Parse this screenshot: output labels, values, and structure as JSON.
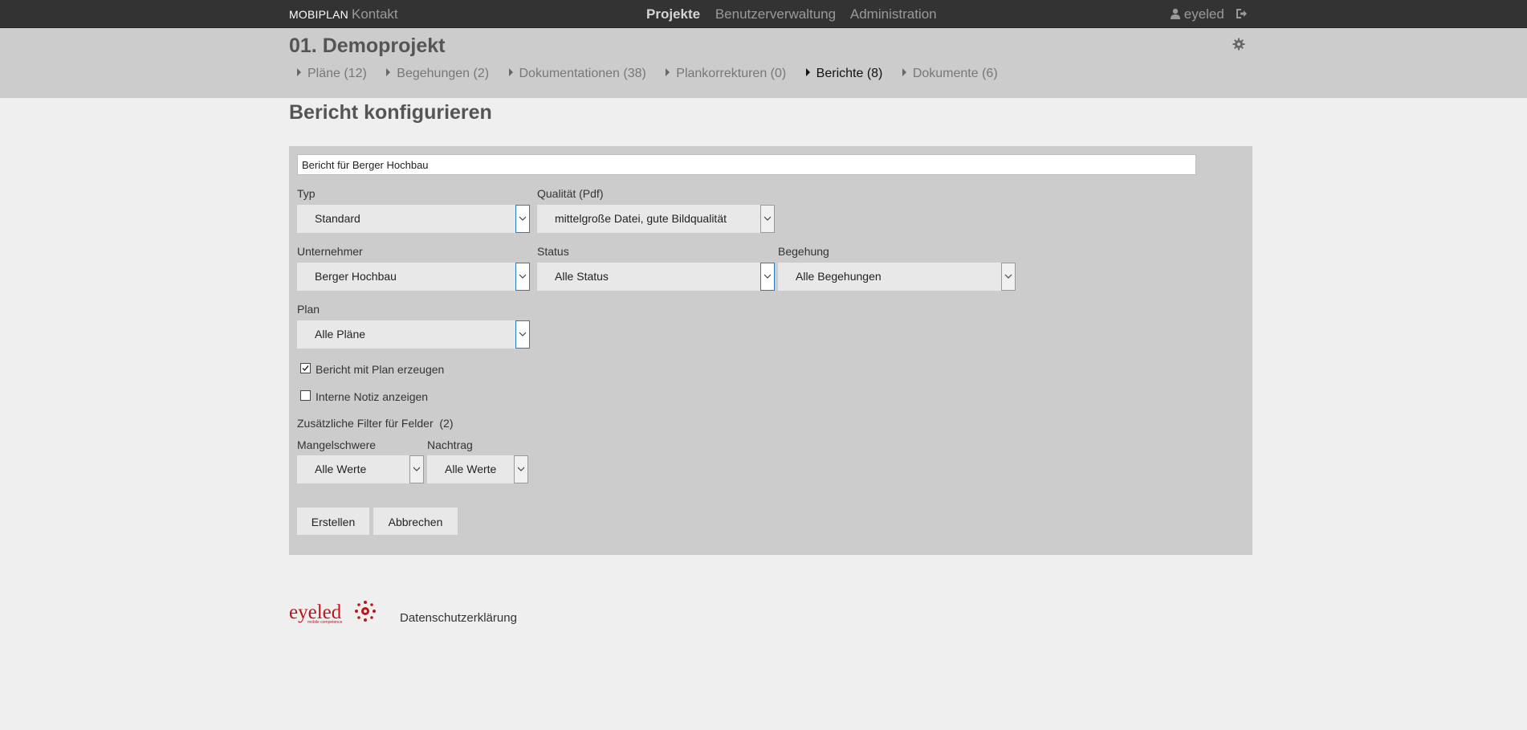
{
  "topbar": {
    "brand": "MOBIPLAN",
    "kontakt": "Kontakt",
    "nav": [
      "Projekte",
      "Benutzerverwaltung",
      "Administration"
    ],
    "user": "eyeled"
  },
  "project": {
    "title": "01. Demoprojekt",
    "tabs": [
      "Pläne (12)",
      "Begehungen (2)",
      "Dokumentationen (38)",
      "Plankorrekturen (0)",
      "Berichte (8)",
      "Dokumente (6)"
    ]
  },
  "page_title": "Bericht konfigurieren",
  "form": {
    "report_name": "Bericht für Berger Hochbau",
    "typ_label": "Typ",
    "typ_value": "Standard",
    "qualitaet_label": "Qualität (Pdf)",
    "qualitaet_value": "mittelgroße Datei, gute Bildqualität",
    "unternehmer_label": "Unternehmer",
    "unternehmer_value": "Berger Hochbau",
    "status_label": "Status",
    "status_value": "Alle Status",
    "begehung_label": "Begehung",
    "begehung_value": "Alle Begehungen",
    "plan_label": "Plan",
    "plan_value": "Alle Pläne",
    "check_plan_label": "Bericht mit Plan erzeugen",
    "check_plan_checked": true,
    "check_notiz_label": "Interne Notiz anzeigen",
    "check_notiz_checked": false,
    "filter_heading": "Zusätzliche Filter für Felder  (2)",
    "mangelschwere_label": "Mangelschwere",
    "mangelschwere_value": "Alle Werte",
    "nachtrag_label": "Nachtrag",
    "nachtrag_value": "Alle Werte",
    "create_button": "Erstellen",
    "cancel_button": "Abbrechen"
  },
  "footer": {
    "logo_text": "eyeled",
    "logo_tagline": "mobile competence",
    "privacy_link": "Datenschutzerklärung"
  },
  "colors": {
    "topbar": "#333333",
    "header": "#cccccc",
    "panel": "#cccccc",
    "focus_border": "#2a7bc0",
    "brand_red": "#c0141c"
  }
}
